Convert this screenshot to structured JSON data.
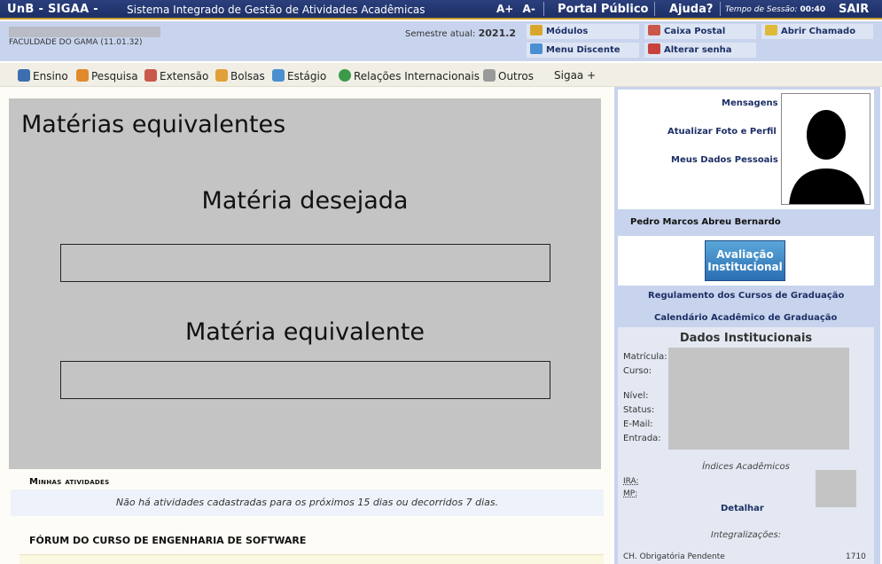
{
  "topbar": {
    "brand": "UnB - SIGAA -",
    "system_title": "Sistema Integrado de Gestão de Atividades Acadêmicas",
    "font_increase": "A+",
    "font_decrease": "A-",
    "portal_publico": "Portal Público",
    "ajuda": "Ajuda?",
    "session_label": "Tempo de Sessão:",
    "session_time": "00:40",
    "sair": "SAIR"
  },
  "subbar": {
    "unit": "FACULDADE DO GAMA (11.01.32)",
    "semester_label": "Semestre atual:",
    "semester_value": "2021.2",
    "quick_links": {
      "modulos": "Módulos",
      "caixa_postal": "Caixa Postal",
      "abrir_chamado": "Abrir Chamado",
      "menu_discente": "Menu Discente",
      "alterar_senha": "Alterar senha"
    }
  },
  "menu": {
    "ensino": "Ensino",
    "pesquisa": "Pesquisa",
    "extensao": "Extensão",
    "bolsas": "Bolsas",
    "estagio": "Estágio",
    "relacoes": "Relações Internacionais",
    "outros": "Outros",
    "sigaa_plus": "Sigaa +"
  },
  "panel": {
    "title": "Matérias equivalentes",
    "desired_label": "Matéria desejada",
    "desired_value": "",
    "equivalent_label": "Matéria equivalente",
    "equivalent_value": ""
  },
  "activities": {
    "title": "Minhas atividades",
    "empty_message": "Não há atividades cadastradas para os próximos 15 dias ou decorridos 7 dias."
  },
  "forum": {
    "title": "FÓRUM DO CURSO DE ENGENHARIA DE SOFTWARE"
  },
  "sidebar": {
    "mensagens": "Mensagens",
    "atualizar_foto": "Atualizar Foto e Perfil",
    "meus_dados": "Meus Dados Pessoais",
    "user_name": "Pedro Marcos Abreu Bernardo",
    "avaliacao_line1": "Avaliação",
    "avaliacao_line2": "Institucional",
    "regulamento": "Regulamento dos Cursos de Graduação",
    "calendario": "Calendário Acadêmico de Graduação",
    "dados_title": "Dados Institucionais",
    "labels": {
      "matricula": "Matrícula:",
      "curso": "Curso:",
      "nivel": "Nível:",
      "status": "Status:",
      "email": "E-Mail:",
      "entrada": "Entrada:"
    },
    "indices_title": "Índices Acadêmicos",
    "ira": "IRA:",
    "mp": "MP:",
    "detalhar": "Detalhar",
    "integralizacoes_title": "Integralizações:",
    "ch_obrigatoria_label": "CH. Obrigatória Pendente",
    "ch_obrigatoria_value": "1710"
  },
  "colors": {
    "topbar": "#1d2f66",
    "accent": "#c79a2c",
    "subbar": "#c8d4ed",
    "panel_gray": "#c4c4c4",
    "link": "#1d2f66"
  }
}
